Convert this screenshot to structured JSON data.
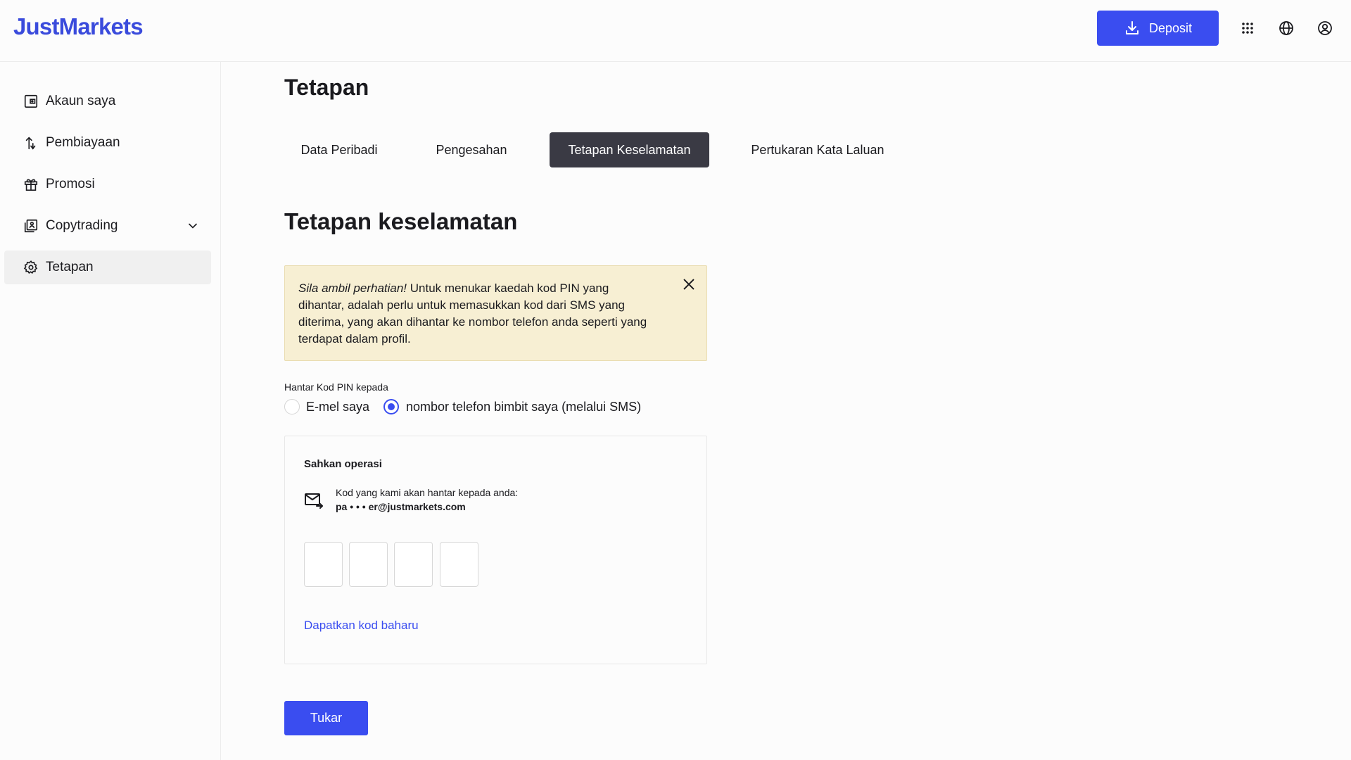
{
  "header": {
    "logo": "JustMarkets",
    "deposit_label": "Deposit",
    "icons": [
      "apps-grid-icon",
      "globe-icon",
      "user-account-icon"
    ]
  },
  "sidebar": {
    "items": [
      {
        "label": "Akaun saya",
        "icon": "account-wallet-icon"
      },
      {
        "label": "Pembiayaan",
        "icon": "transfer-arrows-icon"
      },
      {
        "label": "Promosi",
        "icon": "gift-icon"
      },
      {
        "label": "Copytrading",
        "icon": "copytrading-icon",
        "expandable": true
      },
      {
        "label": "Tetapan",
        "icon": "gear-icon",
        "active": true
      }
    ]
  },
  "main": {
    "page_title": "Tetapan",
    "tabs": [
      {
        "label": "Data Peribadi"
      },
      {
        "label": "Pengesahan"
      },
      {
        "label": "Tetapan Keselamatan",
        "active": true
      },
      {
        "label": "Pertukaran Kata Laluan"
      }
    ],
    "section_title": "Tetapan keselamatan",
    "notice": {
      "emphasis": "Sila ambil perhatian!",
      "text": " Untuk menukar kaedah kod PIN yang dihantar, adalah perlu untuk memasukkan kod dari SMS yang diterima, yang akan dihantar ke nombor telefon anda seperti yang terdapat dalam profil."
    },
    "pin": {
      "label": "Hantar Kod PIN kepada",
      "options": [
        {
          "label": "E-mel saya",
          "checked": false
        },
        {
          "label": "nombor telefon bimbit saya (melalui SMS)",
          "checked": true
        }
      ]
    },
    "confirm": {
      "title": "Sahkan operasi",
      "sent_text": "Kod yang kami akan hantar kepada anda:",
      "email": "pa • • • er@justmarkets.com",
      "code_values": [
        "",
        "",
        "",
        ""
      ],
      "resend_label": "Dapatkan kod baharu"
    },
    "submit_label": "Tukar"
  },
  "colors": {
    "accent": "#3a4df0",
    "logo": "#3a4bdc",
    "notice_bg": "#f7efd3",
    "active_tab_bg": "#3a3a44"
  }
}
